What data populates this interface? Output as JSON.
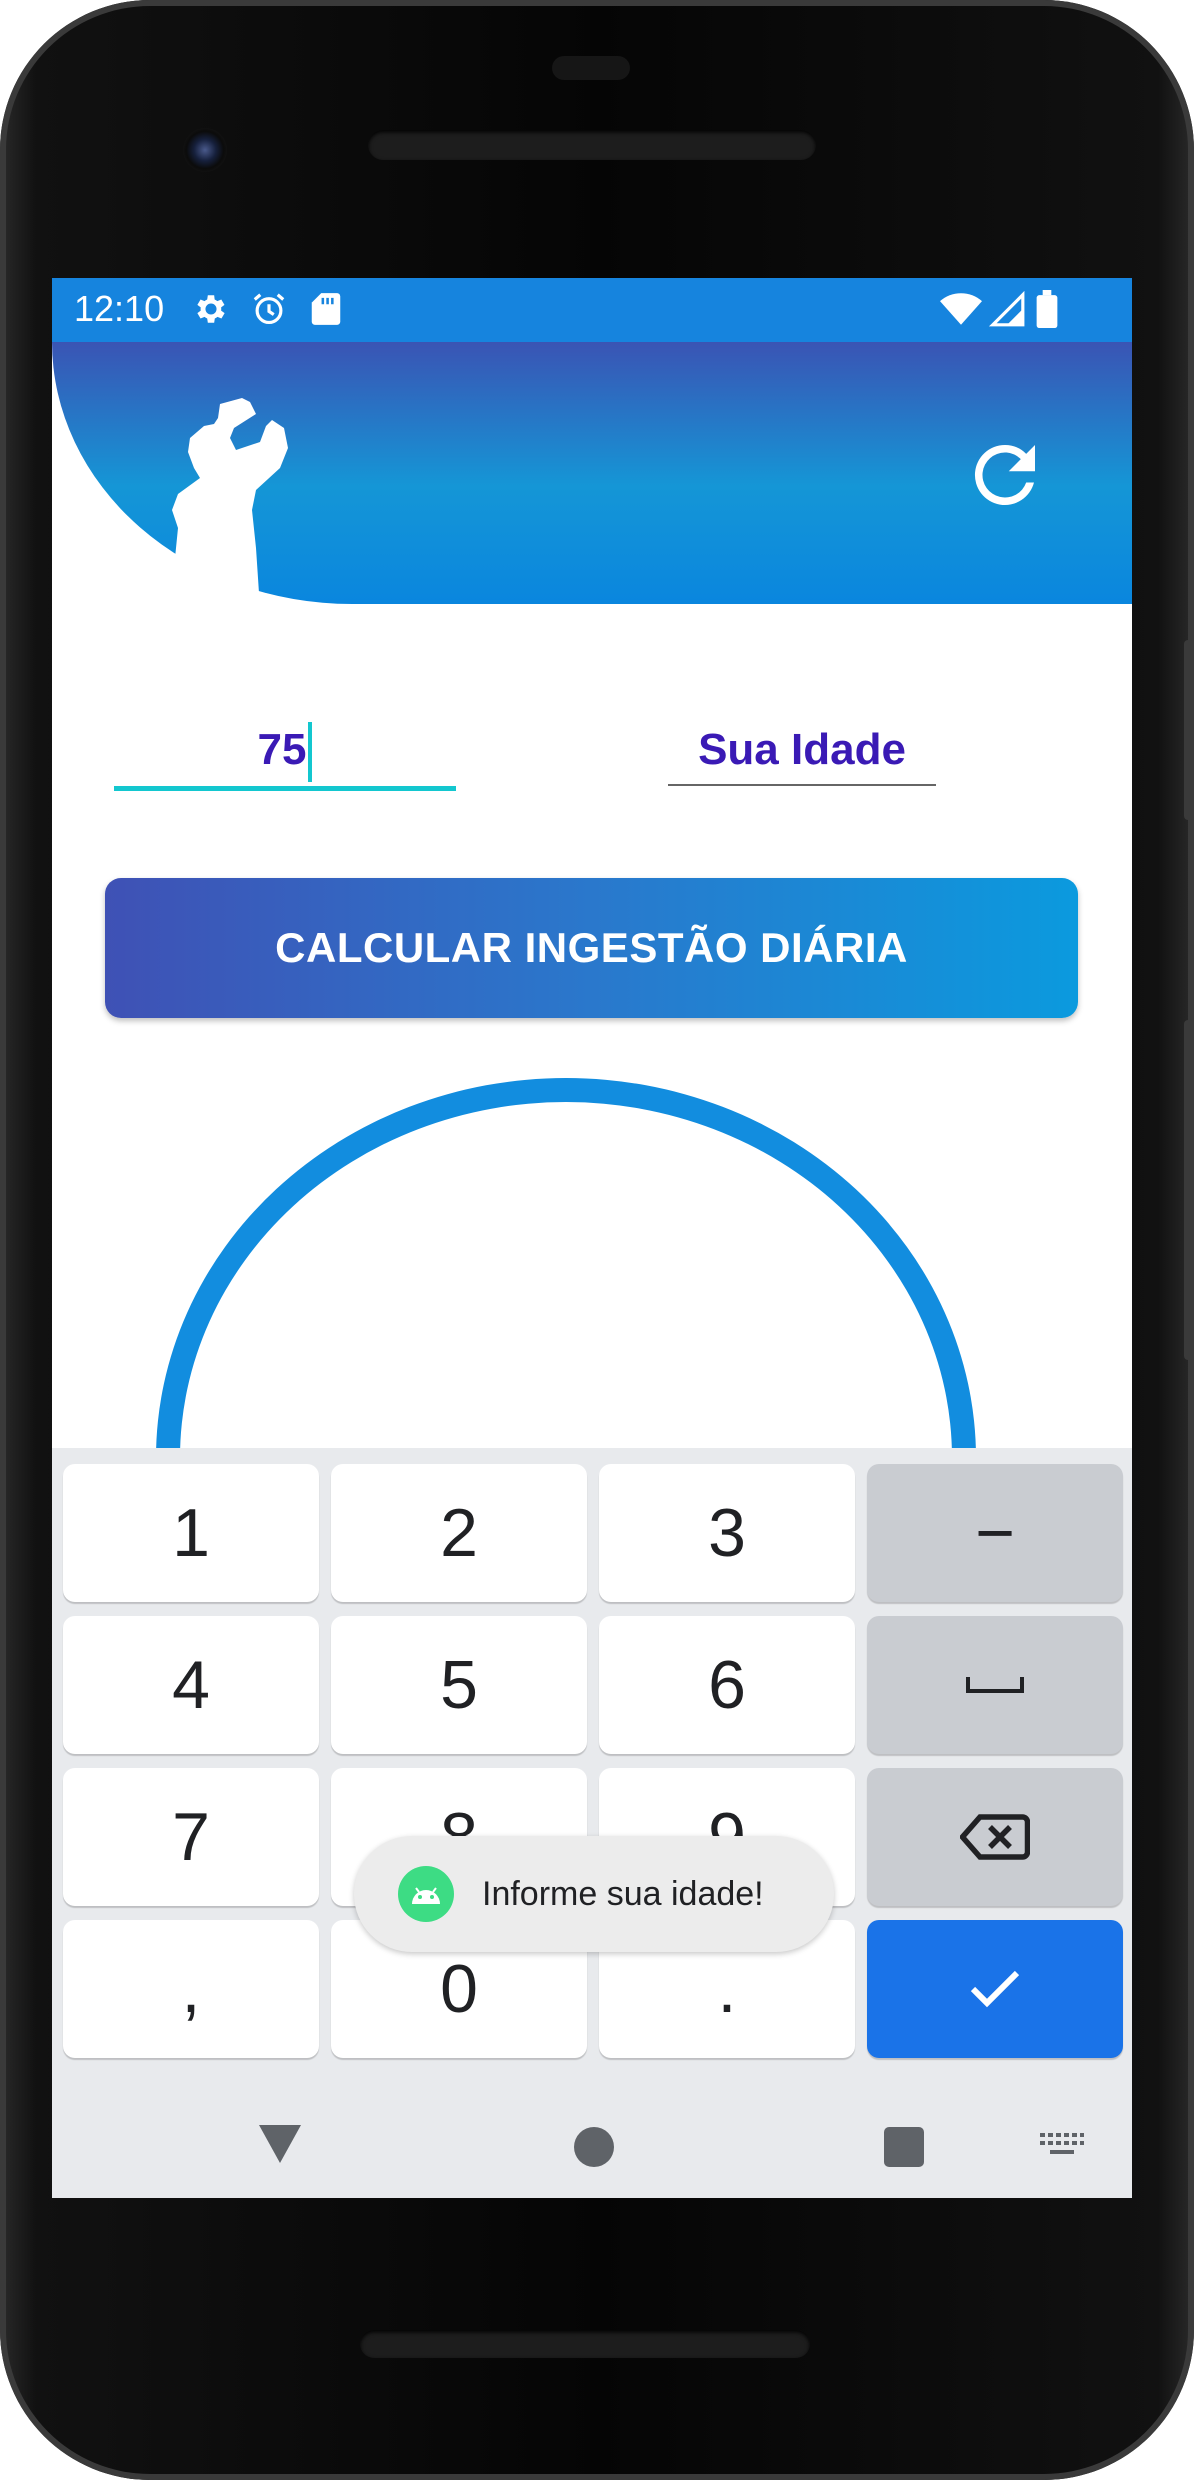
{
  "status_bar": {
    "time": "12:10",
    "icons": [
      "settings-icon",
      "alarm-icon",
      "sd-card-icon",
      "wifi-icon",
      "signal-icon",
      "battery-icon"
    ]
  },
  "header": {
    "image": "drinking-person-silhouette",
    "refresh_icon": "refresh-icon"
  },
  "form": {
    "weight_value": "75",
    "age_placeholder": "Sua Idade",
    "calculate_button_label": "CALCULAR INGESTÃO DIÁRIA"
  },
  "keyboard": {
    "rows": [
      [
        "1",
        "2",
        "3",
        "−"
      ],
      [
        "4",
        "5",
        "6",
        "space-icon"
      ],
      [
        "7",
        "8",
        "9",
        "backspace-icon"
      ],
      [
        ",",
        "0",
        ".",
        "done-check-icon"
      ]
    ]
  },
  "toast": {
    "message": "Informe sua idade!",
    "icon": "android-icon"
  },
  "nav_bar": {
    "icons": [
      "back-icon",
      "home-icon",
      "recent-apps-icon",
      "keyboard-switch-icon"
    ]
  },
  "colors": {
    "status_bar": "#1684de",
    "header_gradient_top": "#3a54b4",
    "header_gradient_bottom": "#0a86de",
    "input_accent": "#13c7cf",
    "input_text": "#3a1ab5",
    "button_gradient_left": "#3f51b5",
    "button_gradient_right": "#0b9ade",
    "ring": "#128ddf",
    "keyboard_done": "#1a73e8"
  }
}
